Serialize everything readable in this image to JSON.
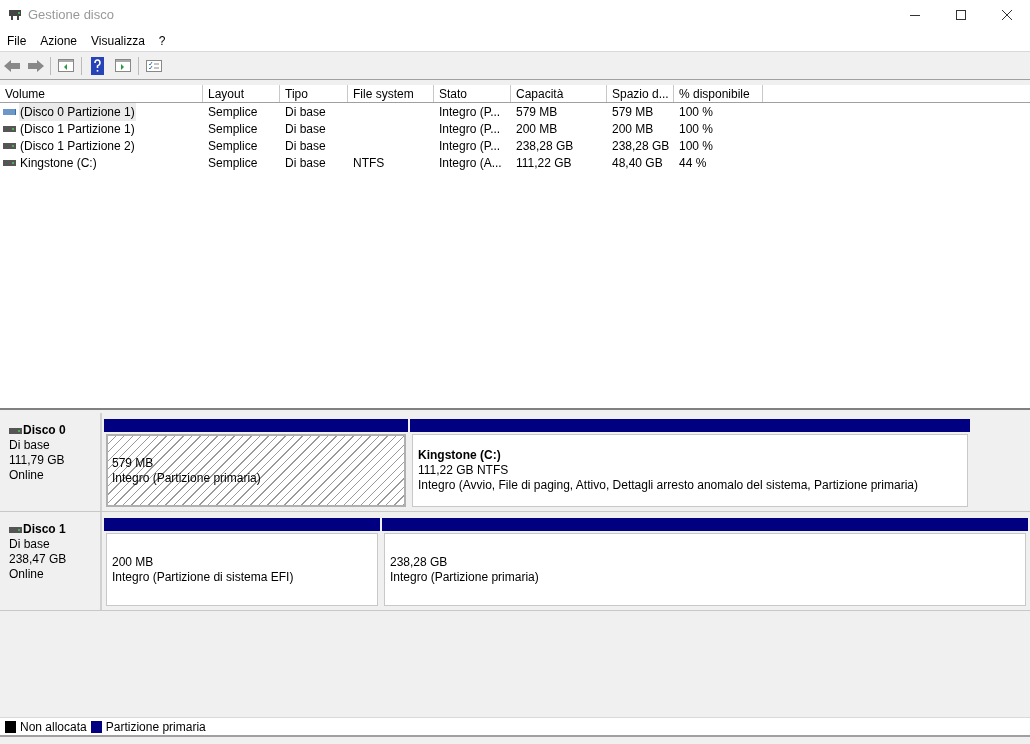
{
  "window": {
    "title": "Gestione disco"
  },
  "menu": [
    "File",
    "Azione",
    "Visualizza",
    "?"
  ],
  "table": {
    "columns": [
      "Volume",
      "Layout",
      "Tipo",
      "File system",
      "Stato",
      "Capacità",
      "Spazio d...",
      "% disponibile"
    ],
    "rows": [
      {
        "selected": true,
        "cells": [
          "(Disco 0 Partizione 1)",
          "Semplice",
          "Di base",
          "",
          "Integro (P...",
          "579 MB",
          "579 MB",
          "100 %"
        ]
      },
      {
        "selected": false,
        "cells": [
          "(Disco 1 Partizione 1)",
          "Semplice",
          "Di base",
          "",
          "Integro (P...",
          "200 MB",
          "200 MB",
          "100 %"
        ]
      },
      {
        "selected": false,
        "cells": [
          "(Disco 1 Partizione 2)",
          "Semplice",
          "Di base",
          "",
          "Integro (P...",
          "238,28 GB",
          "238,28 GB",
          "100 %"
        ]
      },
      {
        "selected": false,
        "cells": [
          "Kingstone (C:)",
          "Semplice",
          "Di base",
          "NTFS",
          "Integro (A...",
          "111,22 GB",
          "48,40 GB",
          "44 %"
        ]
      }
    ]
  },
  "disks": [
    {
      "name": "Disco 0",
      "type": "Di base",
      "size": "111,79 GB",
      "status": "Online",
      "partitions": [
        {
          "selected": true,
          "lines": [
            "579 MB",
            "Integro (Partizione primaria)"
          ]
        },
        {
          "selected": false,
          "title": "Kingstone  (C:)",
          "lines": [
            "111,22 GB NTFS",
            "Integro (Avvio, File di paging, Attivo, Dettagli arresto anomalo del sistema, Partizione primaria)"
          ]
        }
      ]
    },
    {
      "name": "Disco 1",
      "type": "Di base",
      "size": "238,47 GB",
      "status": "Online",
      "partitions": [
        {
          "selected": false,
          "lines": [
            "200 MB",
            "Integro (Partizione di sistema EFI)"
          ]
        },
        {
          "selected": false,
          "lines": [
            "238,28 GB",
            "Integro (Partizione primaria)"
          ]
        }
      ]
    }
  ],
  "legend": [
    {
      "label": "Non allocata",
      "color": "#000000"
    },
    {
      "label": "Partizione primaria",
      "color": "#000080"
    }
  ]
}
